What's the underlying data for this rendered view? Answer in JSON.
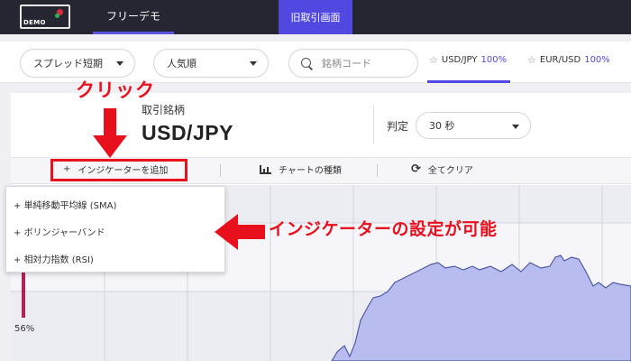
{
  "header": {
    "logo_text": "DEMO",
    "tab_demo": "フリーデモ",
    "tab_old": "旧取引画面"
  },
  "filters": {
    "spread": "スプレッド短期",
    "popular": "人気順",
    "search_placeholder": "銘柄コード"
  },
  "pairs": [
    {
      "name": "USD/JPY",
      "pct": "100%"
    },
    {
      "name": "EUR/USD",
      "pct": "100%"
    }
  ],
  "instrument": {
    "label": "取引銘柄",
    "value": "USD/JPY"
  },
  "judgement": {
    "label": "判定",
    "value": "30 秒"
  },
  "toolbar": {
    "add_indicator": "インジケーターを追加",
    "chart_type": "チャートの種類",
    "clear_all": "全てクリア"
  },
  "indicator_menu": [
    "単純移動平均線 (SMA)",
    "ボリンジャーバンド",
    "相対力指数 (RSI)"
  ],
  "chart_label": "56%",
  "annotations": {
    "click": "クリック",
    "setting": "インジケーターの設定が可能"
  },
  "colors": {
    "accent": "#5048e0",
    "annotation": "#e8101c",
    "chart_fill": "#b8bcee",
    "chart_line": "#4e5aa8"
  }
}
